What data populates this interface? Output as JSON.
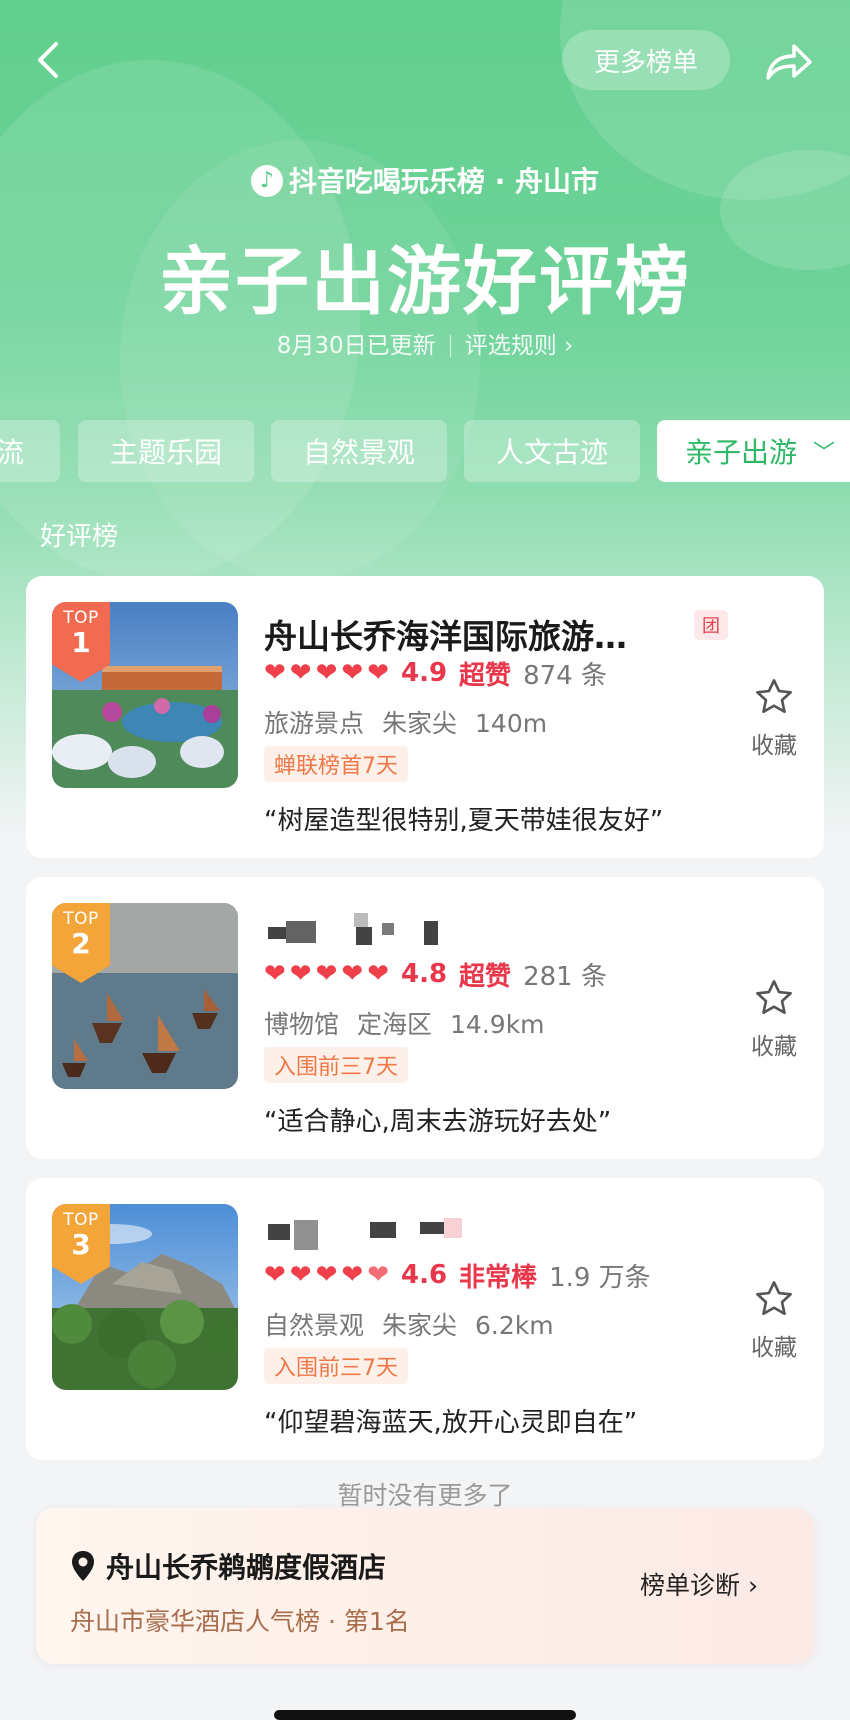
{
  "header": {
    "more_lists": "更多榜单",
    "brand": "抖音吃喝玩乐榜 · 舟山市",
    "title": "亲子出游好评榜",
    "updated": "8月30日已更新",
    "rules": "评选规则 ›"
  },
  "tabs": [
    {
      "label": "流"
    },
    {
      "label": "主题乐园"
    },
    {
      "label": "自然景观"
    },
    {
      "label": "人文古迹"
    },
    {
      "label": "亲子出游",
      "active": true
    }
  ],
  "section_label": "好评榜",
  "items": [
    {
      "rank_top": "TOP",
      "rank_num": "1",
      "name": "舟山长乔海洋国际旅游…",
      "tuan": "团",
      "score": "4.9",
      "grade": "超赞",
      "count": "874 条",
      "category": "旅游景点",
      "area": "朱家尖",
      "distance": "140m",
      "tag": "蝉联榜首7天",
      "quote": "“树屋造型很特别,夏天带娃很友好”",
      "fav": "收藏",
      "hearts": 5
    },
    {
      "rank_top": "TOP",
      "rank_num": "2",
      "score": "4.8",
      "grade": "超赞",
      "count": "281 条",
      "category": "博物馆",
      "area": "定海区",
      "distance": "14.9km",
      "tag": "入围前三7天",
      "quote": "“适合静心,周末去游玩好去处”",
      "fav": "收藏",
      "hearts": 5
    },
    {
      "rank_top": "TOP",
      "rank_num": "3",
      "score": "4.6",
      "grade": "非常棒",
      "count": "1.9 万条",
      "category": "自然景观",
      "area": "朱家尖",
      "distance": "6.2km",
      "tag": "入围前三7天",
      "quote": "“仰望碧海蓝天,放开心灵即自在”",
      "fav": "收藏",
      "hearts": 4.5
    }
  ],
  "end_note": "暂时没有更多了",
  "hotel": {
    "name": "舟山长乔鹈鹕度假酒店",
    "rank": "舟山市豪华酒店人气榜 · 第1名",
    "diag": "榜单诊断 ›"
  },
  "colors": {
    "green": "#62cf8e",
    "red": "#ef3f4b",
    "orange_tag": "#ef7848"
  }
}
